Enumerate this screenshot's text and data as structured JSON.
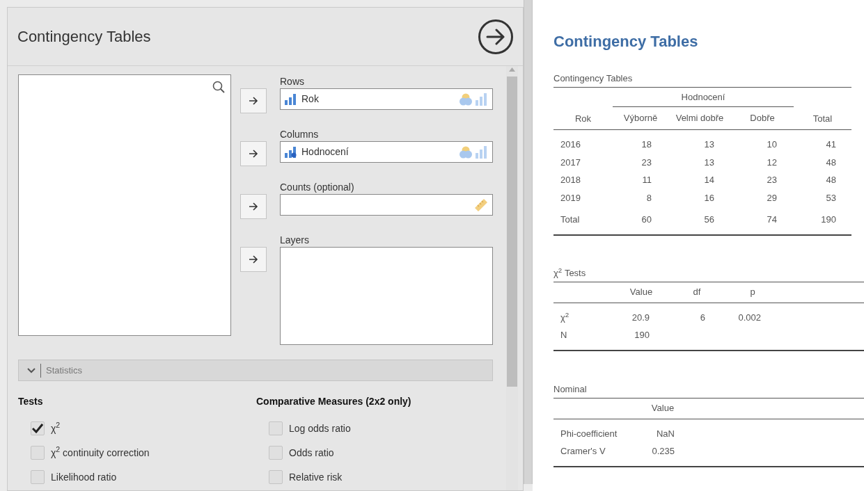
{
  "analysis": {
    "title": "Contingency Tables"
  },
  "targets": [
    {
      "label": "Rows",
      "kind": "factor_field",
      "variable": {
        "name": "Rok",
        "kind": "ordinal"
      }
    },
    {
      "label": "Columns",
      "kind": "factor_field",
      "variable": {
        "name": "Hodnocení",
        "kind": "nominal_text"
      }
    },
    {
      "label": "Counts (optional)",
      "kind": "numeric_field"
    },
    {
      "label": "Layers",
      "kind": "box"
    }
  ],
  "statistics": {
    "label": "Statistics",
    "expanded": true,
    "groups": [
      {
        "heading": "Tests",
        "options": [
          {
            "label": "χ$^{2}$",
            "checked": true
          },
          {
            "label": "χ$^{2}$ continuity correction",
            "checked": false
          },
          {
            "label": "Likelihood ratio",
            "checked": false
          }
        ]
      },
      {
        "heading": "Comparative Measures (2x2 only)",
        "options": [
          {
            "label": "Log odds ratio",
            "checked": false
          },
          {
            "label": "Odds ratio",
            "checked": false
          },
          {
            "label": "Relative risk",
            "checked": false
          }
        ]
      }
    ]
  },
  "results": {
    "title": "Contingency Tables",
    "contingency": {
      "caption": "Contingency Tables",
      "row_header": "Rok",
      "group_header": "Hodnocení",
      "columns": [
        "Výborně",
        "Velmi dobře",
        "Dobře"
      ],
      "total_header": "Total",
      "rows": [
        {
          "label": "2016",
          "values": [
            "18",
            "13",
            "10"
          ],
          "total": "41"
        },
        {
          "label": "2017",
          "values": [
            "23",
            "13",
            "12"
          ],
          "total": "48"
        },
        {
          "label": "2018",
          "values": [
            "11",
            "14",
            "23"
          ],
          "total": "48"
        },
        {
          "label": "2019",
          "values": [
            "8",
            "16",
            "29"
          ],
          "total": "53"
        }
      ],
      "total_row": {
        "label": "Total",
        "values": [
          "60",
          "56",
          "74"
        ],
        "total": "190"
      }
    },
    "chi_tests": {
      "caption": "χ$^{2}$ Tests",
      "columns": [
        "Value",
        "df",
        "p"
      ],
      "rows": [
        {
          "label": "χ$^{2}$",
          "cells": [
            "20.9",
            "6",
            "0.002"
          ]
        },
        {
          "label": "N",
          "cells": [
            "190"
          ]
        }
      ]
    },
    "nominal": {
      "caption": "Nominal",
      "columns": [
        "Value"
      ],
      "rows": [
        {
          "label": "Phi-coefficient",
          "cells": [
            "NaN"
          ]
        },
        {
          "label": "Cramer's V",
          "cells": [
            "0.235"
          ]
        }
      ]
    }
  }
}
